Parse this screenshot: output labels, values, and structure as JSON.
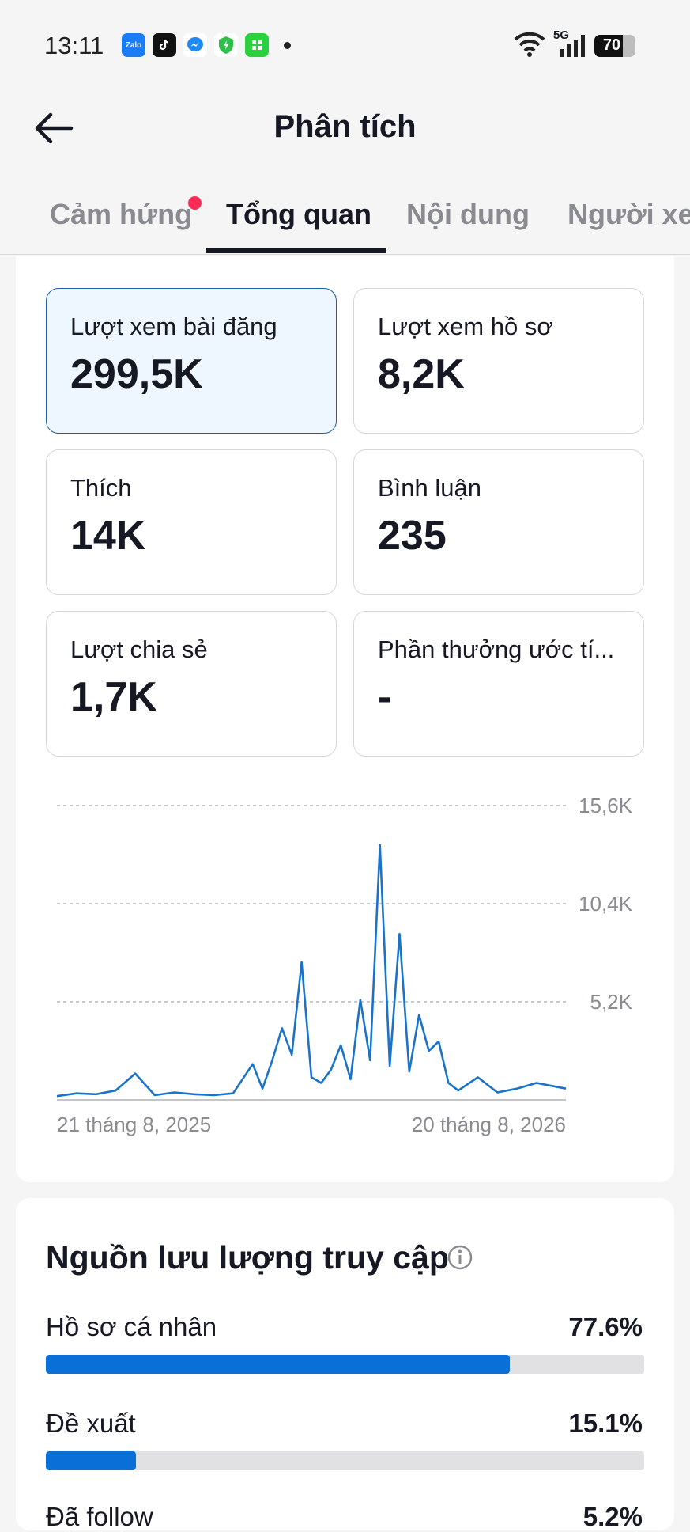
{
  "status_bar": {
    "time": "13:11",
    "network": "5G",
    "battery": "70",
    "notification_icons": [
      "zalo-icon",
      "tiktok-icon",
      "messenger-icon",
      "shield-icon",
      "app-icon"
    ]
  },
  "header": {
    "title": "Phân tích"
  },
  "tabs": [
    {
      "label": "Cảm hứng",
      "active": false,
      "has_dot": true
    },
    {
      "label": "Tổng quan",
      "active": true,
      "has_dot": false
    },
    {
      "label": "Nội dung",
      "active": false,
      "has_dot": false
    },
    {
      "label": "Người xem",
      "active": false,
      "has_dot": false
    }
  ],
  "metrics": [
    {
      "label": "Lượt xem bài đăng",
      "value": "299,5K",
      "selected": true
    },
    {
      "label": "Lượt xem hồ sơ",
      "value": "8,2K",
      "selected": false
    },
    {
      "label": "Thích",
      "value": "14K",
      "selected": false
    },
    {
      "label": "Bình luận",
      "value": "235",
      "selected": false
    },
    {
      "label": "Lượt chia sẻ",
      "value": "1,7K",
      "selected": false
    },
    {
      "label": "Phần thưởng ước tí...",
      "value": "-",
      "selected": false
    }
  ],
  "chart_data": {
    "type": "line",
    "x_start_label": "21 tháng 8, 2025",
    "x_end_label": "20 tháng 8, 2026",
    "y_ticks": [
      "5,2K",
      "10,4K",
      "15,6K"
    ],
    "y_tick_values": [
      5200,
      10400,
      15600
    ],
    "ylim": [
      0,
      15600
    ],
    "grid": "dashed horizontal",
    "series_color": "#1a73c8",
    "x": [
      "2025-08-21",
      "2025-09-04",
      "2025-09-18",
      "2025-10-02",
      "2025-10-16",
      "2025-10-30",
      "2025-11-13",
      "2025-11-27",
      "2025-12-11",
      "2025-12-25",
      "2026-01-08",
      "2026-01-15",
      "2026-01-22",
      "2026-01-29",
      "2026-02-05",
      "2026-02-12",
      "2026-02-19",
      "2026-02-26",
      "2026-03-05",
      "2026-03-12",
      "2026-03-19",
      "2026-03-26",
      "2026-04-02",
      "2026-04-09",
      "2026-04-16",
      "2026-04-23",
      "2026-04-30",
      "2026-05-07",
      "2026-05-14",
      "2026-05-21",
      "2026-05-28",
      "2026-06-04",
      "2026-06-18",
      "2026-07-02",
      "2026-07-16",
      "2026-07-30",
      "2026-08-13",
      "2026-08-20"
    ],
    "values": [
      200,
      350,
      300,
      500,
      1400,
      250,
      400,
      300,
      250,
      350,
      1900,
      600,
      2100,
      3800,
      2400,
      7300,
      1200,
      900,
      1600,
      2900,
      1100,
      5300,
      2100,
      13500,
      1800,
      8800,
      1500,
      4500,
      2600,
      3100,
      900,
      500,
      1200,
      400,
      600,
      900,
      700,
      600
    ]
  },
  "traffic": {
    "title": "Nguồn lưu lượng truy cập",
    "sources": [
      {
        "label": "Hồ sơ cá nhân",
        "percent_text": "77.6%",
        "fraction": 0.776
      },
      {
        "label": "Đề xuất",
        "percent_text": "15.1%",
        "fraction": 0.151
      },
      {
        "label": "Đã follow",
        "percent_text": "5.2%",
        "fraction": 0.052
      }
    ]
  }
}
